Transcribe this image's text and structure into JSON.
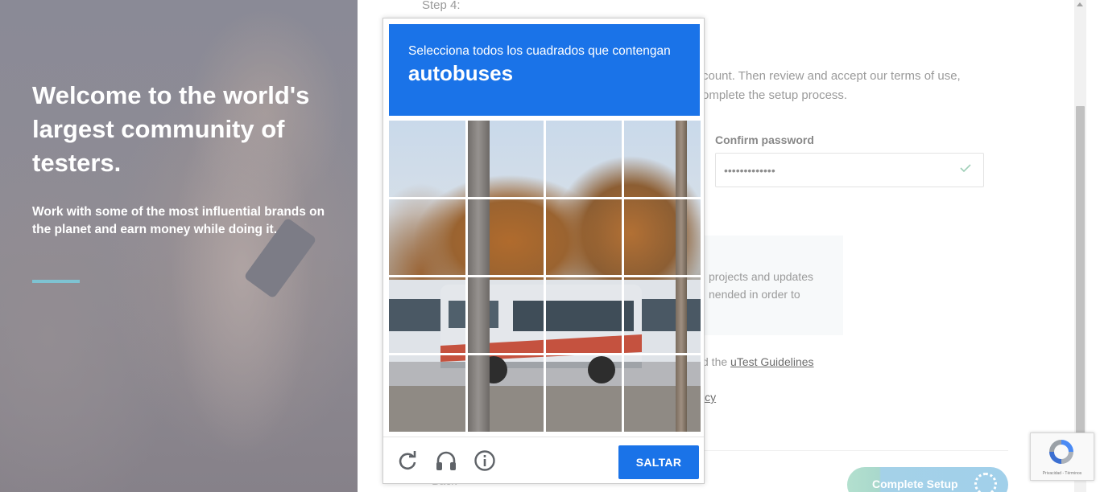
{
  "hero": {
    "title": "Welcome to the world's largest community of testers.",
    "subtitle": "Work with some of the most influential brands on the planet and earn money while doing it.",
    "accent_color": "#7ec3d2"
  },
  "form": {
    "step_label": "Step 4:",
    "intro_text": "count. Then review and accept our terms of use, omplete the setup process.",
    "confirm_password": {
      "label": "Confirm password",
      "value": "•••••••••••••",
      "valid_icon": "checkmark-icon"
    },
    "info_text": "projects and updates nended in order to",
    "guidelines_prefix": "d the ",
    "guidelines_link": "uTest Guidelines",
    "policy_link": "icy",
    "back_label": "< Back",
    "complete_label": "Complete Setup"
  },
  "captcha": {
    "instruction": "Selecciona todos los cuadrados que contengan",
    "keyword": "autobuses",
    "header_color": "#1a73e8",
    "grid_size": 4,
    "reload_icon": "reload-icon",
    "audio_icon": "headphones-icon",
    "info_icon": "info-icon",
    "skip_label": "SALTAR"
  },
  "recaptcha_badge": {
    "legal": "Privacidad - Términos"
  }
}
